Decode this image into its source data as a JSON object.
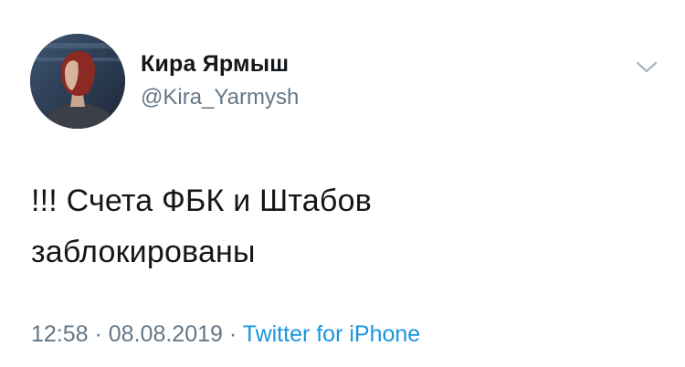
{
  "author": {
    "name": "Кира Ярмыш",
    "handle": "@Kira_Yarmysh",
    "avatar_icon": "user-avatar-photo"
  },
  "menu": {
    "icon": "chevron-down-icon"
  },
  "tweet": {
    "text_line1": "!!! Счета ФБК и Штабов",
    "text_line2": "заблокированы"
  },
  "meta": {
    "time": "12:58",
    "sep1": " · ",
    "date": "08.08.2019",
    "sep2": " · ",
    "source": "Twitter for iPhone"
  },
  "colors": {
    "text": "#14171a",
    "secondary": "#657786",
    "link": "#1b95e0",
    "background": "#ffffff"
  }
}
